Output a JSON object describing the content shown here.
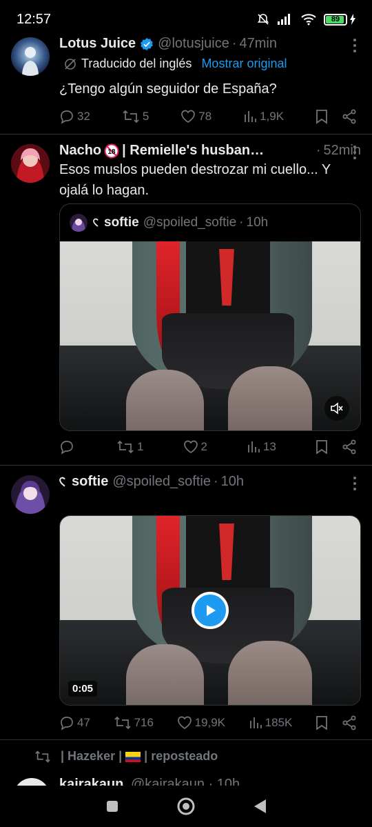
{
  "status_bar": {
    "time": "12:57",
    "battery": "89"
  },
  "tweets": [
    {
      "name": "Lotus Juice",
      "handle": "@lotusjuice",
      "time": "47min",
      "translated_label": "Traducido del inglés",
      "show_original": "Mostrar original",
      "text": "¿Tengo algún seguidor de España?",
      "stats": {
        "replies": "32",
        "reposts": "5",
        "likes": "78",
        "views": "1,9K"
      }
    },
    {
      "name": "Nacho",
      "name_suffix": "| Remielle's husband ...",
      "time": "52min",
      "text": "Esos muslos pueden destrozar mi cuello... Y ojalá lo hagan.",
      "quote": {
        "name": "softie",
        "handle": "@spoiled_softie",
        "time": "10h"
      },
      "stats": {
        "replies": "",
        "reposts": "1",
        "likes": "2",
        "views": "13"
      }
    },
    {
      "name": "softie",
      "handle": "@spoiled_softie",
      "time": "10h",
      "video_duration": "0:05",
      "stats": {
        "replies": "47",
        "reposts": "716",
        "likes": "19,9K",
        "views": "185K"
      }
    }
  ],
  "repost_banner": {
    "name": "| Hazeker |",
    "label": "| reposteado"
  },
  "next_tweet": {
    "name": "kairakaun",
    "meta": "@kairakaun · 10h"
  },
  "colors": {
    "accent": "#1d9bf0",
    "muted": "#71767b",
    "text": "#e7e9ea",
    "background": "#000000"
  }
}
